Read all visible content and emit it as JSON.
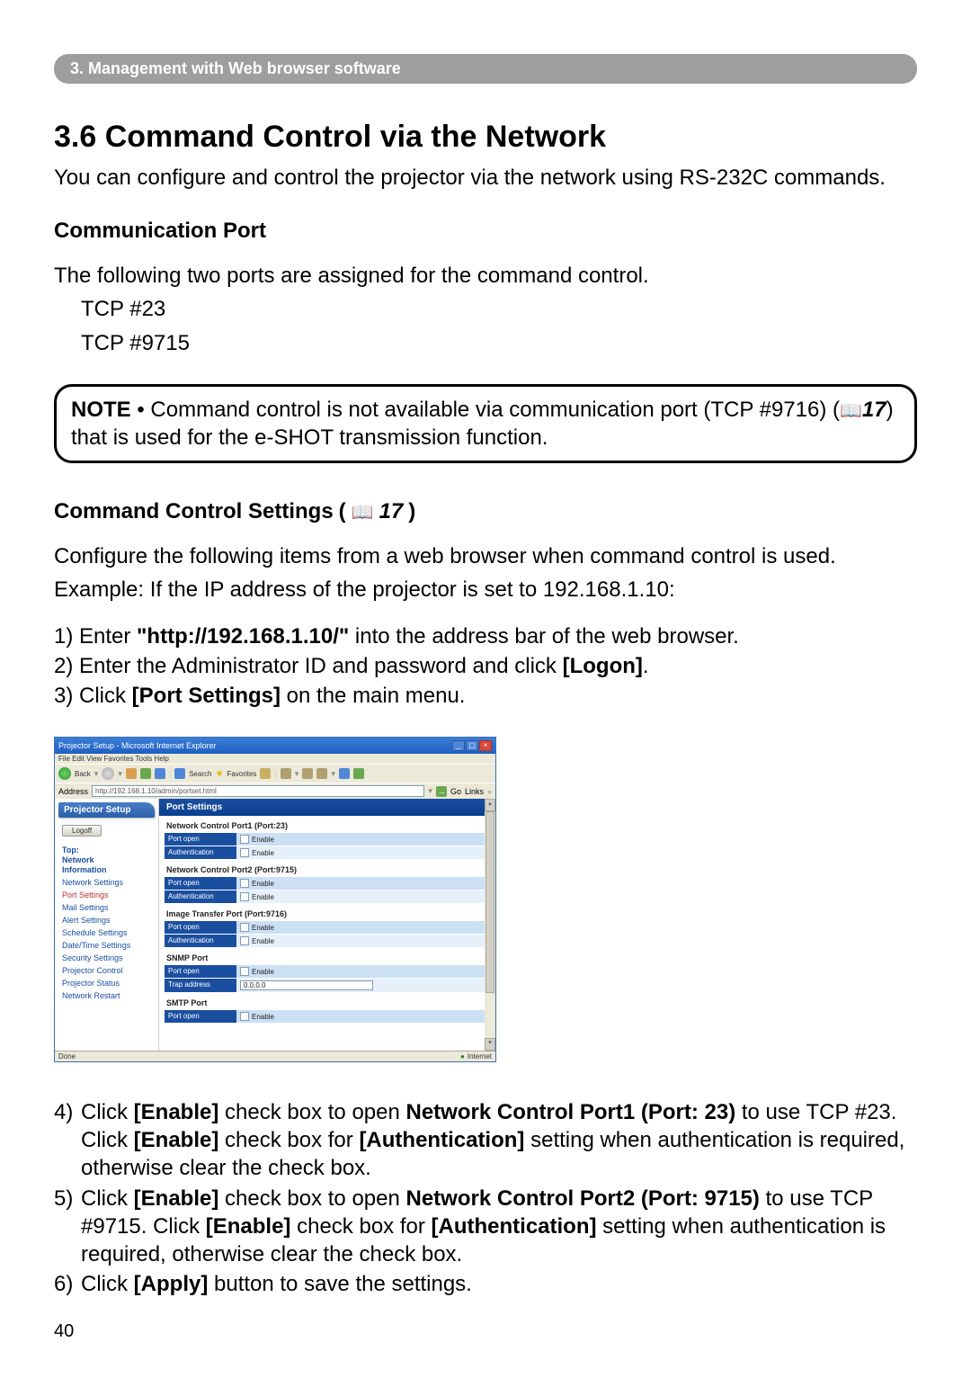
{
  "header_bar": "3. Management with Web browser software",
  "main_heading": "3.6 Command Control via the Network",
  "intro": "You can configure and control the projector via the network using RS-232C commands.",
  "comm_port_heading": "Communication Port",
  "comm_port_text": "The following two ports are assigned for the command control.",
  "comm_port_line1": "TCP #23",
  "comm_port_line2": "TCP #9715",
  "note_label": "NOTE",
  "note_bullet": "•",
  "note_text_a": " Command control is not available via communication port (TCP #9716) (",
  "note_ref": "17",
  "note_text_b": " that is used for the e-SHOT transmission function.",
  "note_paren_close": ")",
  "ccs_heading": "Command Control Settings",
  "ccs_heading_paren_open": "(",
  "ccs_heading_ref": "17",
  "ccs_heading_paren_close": ")",
  "ccs_text1": "Configure the following items from a web browser when command control is used.",
  "ccs_text2": "Example: If the IP address of the projector is set to 192.168.1.10:",
  "step1_pre": "1) Enter ",
  "step1_bold": "\"http://192.168.1.10/\"",
  "step1_post": " into the address bar of the web browser.",
  "step2_pre": "2) Enter the Administrator ID and password and click ",
  "step2_bold": "[Logon]",
  "step2_post": ".",
  "step3_pre": "3) Click ",
  "step3_bold": "[Port Settings]",
  "step3_post": " on the main menu.",
  "step4_num": "4)",
  "step4_a": " Click ",
  "step4_b1": "[Enable]",
  "step4_c": " check box to open ",
  "step4_b2": "Network Control Port1 (Port: 23)",
  "step4_d": " to use TCP #23. Click ",
  "step4_b3": "[Enable]",
  "step4_e": " check box for ",
  "step4_b4": "[Authentication]",
  "step4_f": " setting when authentication is required, otherwise clear the check box.",
  "step5_num": "5)",
  "step5_a": " Click ",
  "step5_b1": "[Enable]",
  "step5_c": " check box to open ",
  "step5_b2": "Network Control Port2 (Port: 9715)",
  "step5_d": " to use TCP #9715. Click ",
  "step5_b3": "[Enable]",
  "step5_e": " check box for ",
  "step5_b4": "[Authentication]",
  "step5_f": " setting when authentication is required, otherwise clear the check box.",
  "step6_num": "6)",
  "step6_a": " Click ",
  "step6_b1": "[Apply]",
  "step6_c": " button to save the settings.",
  "page_number": "40",
  "ie": {
    "title": "Projector Setup - Microsoft Internet Explorer",
    "menus": "File   Edit   View   Favorites   Tools   Help",
    "toolbar_back": "Back",
    "toolbar_search": "Search",
    "toolbar_fav": "Favorites",
    "address_label": "Address",
    "url": "http://192.168.1.10/admin/portset.html",
    "go": "Go",
    "links": "Links",
    "sidebar_header": "Projector Setup",
    "logoff": "Logoff",
    "side_top": "Top:",
    "side_network": "Network",
    "side_information": "Information",
    "side_items": [
      "Network Settings",
      "Port Settings",
      "Mail Settings",
      "Alert Settings",
      "Schedule Settings",
      "Date/Time Settings",
      "Security Settings",
      "Projector Control",
      "Projector Status",
      "Network Restart"
    ],
    "main_header": "Port Settings",
    "sect1": "Network Control Port1 (Port:23)",
    "sect2": "Network Control Port2 (Port:9715)",
    "sect3": "Image Transfer Port (Port:9716)",
    "sect4": "SNMP Port",
    "sect5": "SMTP Port",
    "lbl_portopen": "Port open",
    "lbl_auth": "Authentication",
    "lbl_trap": "Trap address",
    "val_enable": "Enable",
    "val_trap": "0.0.0.0",
    "status_done": "Done",
    "status_zone": "Internet"
  }
}
